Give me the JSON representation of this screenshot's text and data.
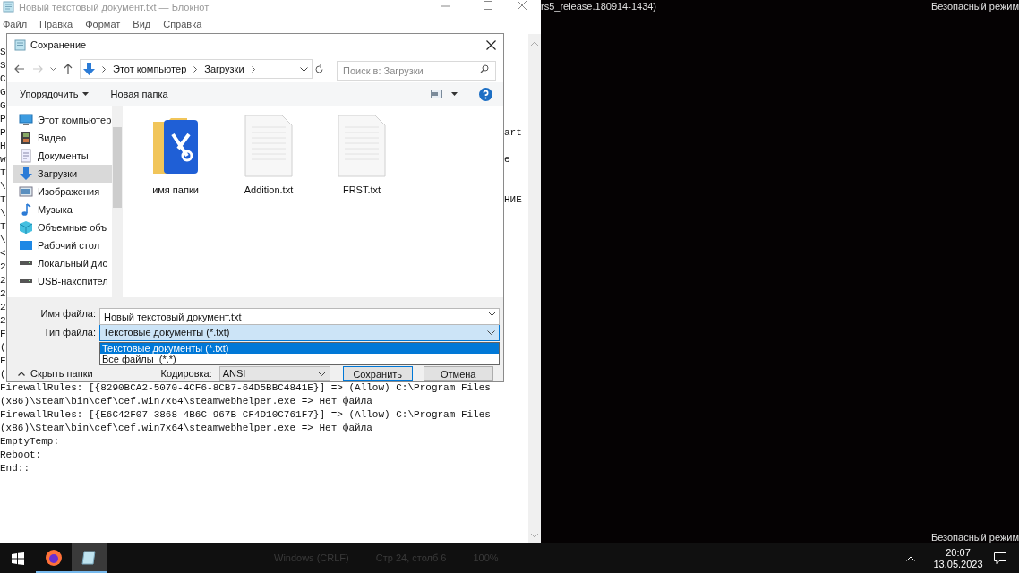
{
  "desktop": {
    "top_text": "rs5_release.180914-1434)",
    "top_right_text": "Безопасный режим",
    "bottom_right_text": "Безопасный режим"
  },
  "notepad": {
    "title": "Новый текстовый документ.txt — Блокнот",
    "menu": [
      "Файл",
      "Правка",
      "Формат",
      "Вид",
      "Справка"
    ],
    "lines": [
      {
        "text": "S"
      },
      {
        "text": "S"
      },
      {
        "text": "C"
      },
      {
        "text": "G"
      },
      {
        "text": "G"
      },
      {
        "text": "P"
      },
      {
        "text": "P",
        "right": "art"
      },
      {
        "text": "H"
      },
      {
        "text": "w",
        "right": "e"
      },
      {
        "text": "T"
      },
      {
        "text": "\\"
      },
      {
        "text": "T",
        "right": "НИЕ"
      },
      {
        "text": "\\"
      },
      {
        "text": "T"
      },
      {
        "text": "\\"
      },
      {
        "text": "<"
      },
      {
        "text": "2"
      },
      {
        "text": "2"
      },
      {
        "text": "2"
      },
      {
        "text": "2"
      },
      {
        "text": "2"
      },
      {
        "text": "F"
      },
      {
        "text": "("
      },
      {
        "text": "F"
      },
      {
        "text": "("
      },
      {
        "text": "FirewallRules: [{8290BCA2-5070-4CF6-8CB7-64D5BBC4841E}] => (Allow) C:\\Program Files"
      },
      {
        "text": "(x86)\\Steam\\bin\\cef\\cef.win7x64\\steamwebhelper.exe => Нет файла"
      },
      {
        "text": "FirewallRules: [{E6C42F07-3868-4B6C-967B-CF4D10C761F7}] => (Allow) C:\\Program Files"
      },
      {
        "text": "(x86)\\Steam\\bin\\cef\\cef.win7x64\\steamwebhelper.exe => Нет файла"
      },
      {
        "text": "EmptyTemp:"
      },
      {
        "text": "Reboot:"
      },
      {
        "text": "End::"
      }
    ],
    "status_bar": [
      "Windows (CRLF)",
      "Стр 24, столб 6",
      "100%"
    ]
  },
  "dialog": {
    "title": "Сохранение",
    "breadcrumb": [
      "Этот компьютер",
      "Загрузки"
    ],
    "search_placeholder": "Поиск в: Загрузки",
    "organize": "Упорядочить",
    "new_folder": "Новая папка",
    "nav": [
      {
        "label": "Этот компьютер",
        "kind": "computer",
        "selected": false
      },
      {
        "label": "Видео",
        "kind": "video",
        "selected": false
      },
      {
        "label": "Документы",
        "kind": "documents",
        "selected": false
      },
      {
        "label": "Загрузки",
        "kind": "downloads",
        "selected": true
      },
      {
        "label": "Изображения",
        "kind": "pictures",
        "selected": false
      },
      {
        "label": "Музыка",
        "kind": "music",
        "selected": false
      },
      {
        "label": "Объемные объ",
        "kind": "objects3d",
        "selected": false
      },
      {
        "label": "Рабочий стол",
        "kind": "desktop",
        "selected": false
      },
      {
        "label": "Локальный дис",
        "kind": "drive",
        "selected": false
      },
      {
        "label": "USB-накопител",
        "kind": "drive",
        "selected": false
      }
    ],
    "files": [
      {
        "name": "имя папки",
        "kind": "folder"
      },
      {
        "name": "Addition.txt",
        "kind": "document"
      },
      {
        "name": "FRST.txt",
        "kind": "document"
      }
    ],
    "filename_label": "Имя файла:",
    "filename": "Новый текстовый документ.txt",
    "filetype_label": "Тип файла:",
    "filetype": "Текстовые документы (*.txt)",
    "filetype_options": [
      {
        "label": "Текстовые документы (*.txt)",
        "selected": true
      },
      {
        "label": "Все файлы  (*.*)",
        "selected": false
      }
    ],
    "hide_folders": "Скрыть папки",
    "encoding_label": "Кодировка:",
    "encoding": "ANSI",
    "save": "Сохранить",
    "cancel": "Отмена"
  },
  "taskbar": {
    "apps": [
      {
        "kind": "firefox",
        "selected": false
      },
      {
        "kind": "notepad",
        "selected": true
      }
    ],
    "time": "20:07",
    "date": "13.05.2023"
  }
}
